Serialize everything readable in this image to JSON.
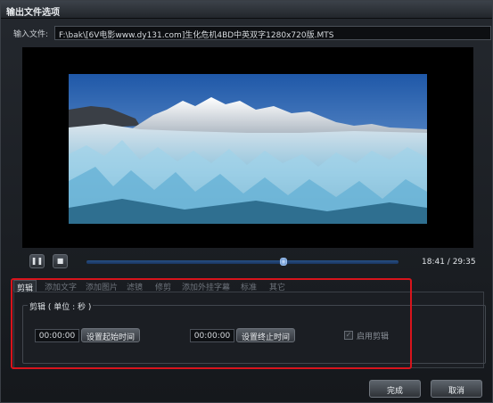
{
  "window": {
    "title": "输出文件选项"
  },
  "input": {
    "label": "输入文件:",
    "path": "F:\\bak\\[6V电影www.dy131.com]生化危机4BD中英双字1280x720版.MTS"
  },
  "player": {
    "time_display": "18:41 / 29:35",
    "progress_fraction": 0.63,
    "buttons": [
      {
        "name": "pause-button",
        "icon": "pause-icon",
        "glyph": "❚❚"
      },
      {
        "name": "stop-button",
        "icon": "stop-icon",
        "glyph": "■"
      }
    ]
  },
  "tabs": [
    {
      "label": "剪辑",
      "active": true
    },
    {
      "label": "添加文字",
      "active": false
    },
    {
      "label": "添加图片",
      "active": false
    },
    {
      "label": "滤镜",
      "active": false
    },
    {
      "label": "修剪",
      "active": false
    },
    {
      "label": "添加外挂字幕",
      "active": false
    },
    {
      "label": "标准",
      "active": false
    },
    {
      "label": "其它",
      "active": false
    }
  ],
  "clip": {
    "group_title": "剪辑 ( 单位 : 秒 )",
    "start_value": "00:00:00",
    "start_button": "设置起始时间",
    "end_value": "00:00:00",
    "end_button": "设置终止时间",
    "enable_label": "启用剪辑",
    "enable_checked": true
  },
  "footer": {
    "ok_label": "完成",
    "cancel_label": "取消"
  },
  "colors": {
    "highlight": "#d8141c",
    "seek_bar": "#274f85"
  }
}
